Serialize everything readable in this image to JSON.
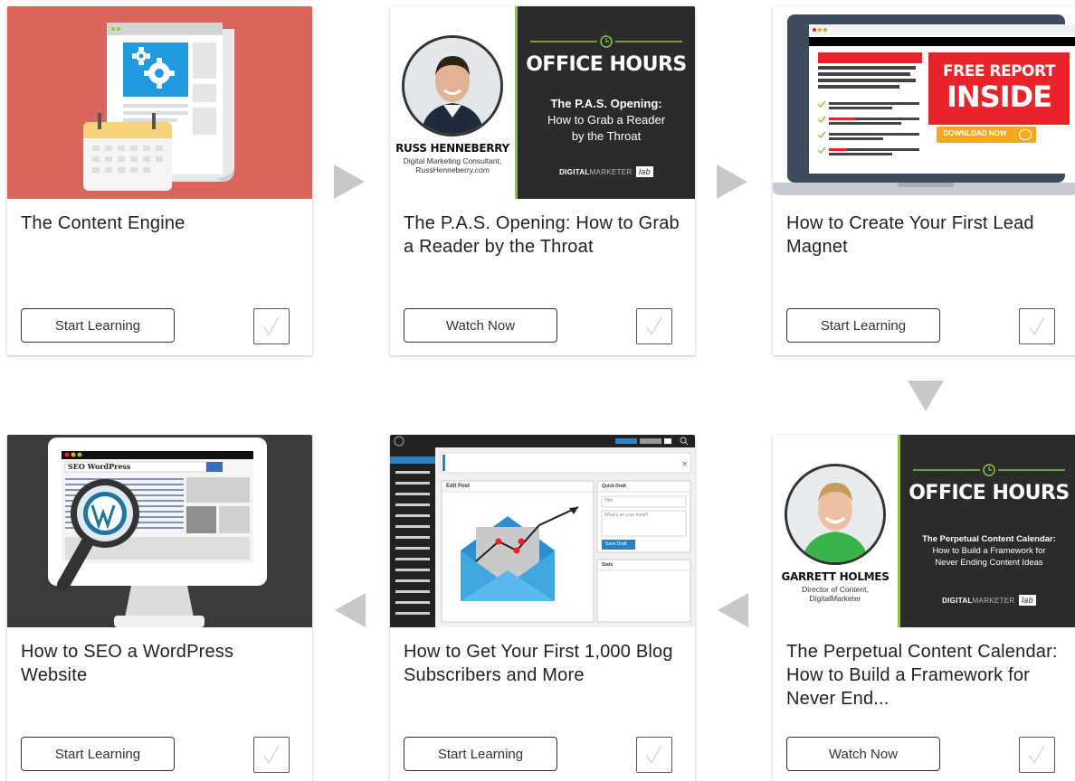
{
  "courses": [
    {
      "title": "The Content Engine",
      "button": "Start Learning"
    },
    {
      "title": "The P.A.S. Opening: How to Grab a Reader by the Throat",
      "button": "Watch Now",
      "thumb": {
        "person": "RUSS HENNEBERRY",
        "role_line1": "Digital Marketing Consultant,",
        "role_line2": "RussHenneberry.com",
        "banner": "OFFICE HOURS",
        "subtitle_bold": "The P.A.S. Opening:",
        "subtitle_rest1": "How to Grab a Reader",
        "subtitle_rest2": "by the Throat",
        "brand_bold": "DIGITAL",
        "brand_light": "MARKETER",
        "brand_lab": "lab"
      }
    },
    {
      "title": "How to Create Your First Lead Magnet",
      "button": "Start Learning",
      "thumb": {
        "report_line1": "FREE REPORT",
        "report_line2": "INSIDE",
        "download": "DOWNLOAD NOW"
      }
    },
    {
      "title": "How to SEO a WordPress Website",
      "button": "Start Learning",
      "thumb": {
        "search_text": "SEO WordPress"
      }
    },
    {
      "title": "How to Get Your First 1,000 Blog Subscribers and More",
      "button": "Start Learning",
      "thumb": {
        "edit_post": "Edit Post",
        "quick_draft": "Quick Draft",
        "title_placeholder": "Title",
        "mind_placeholder": "What's on your mind?",
        "save_draft": "Save Draft",
        "stats": "Stats"
      }
    },
    {
      "title": "The Perpetual Content Calendar: How to Build a Framework for Never End...",
      "button": "Watch Now",
      "thumb": {
        "person": "GARRETT HOLMES",
        "role_line1": "Director of Content,",
        "role_line2": "DigitalMarketer",
        "banner": "OFFICE HOURS",
        "subtitle_bold": "The Perpetual Content Calendar:",
        "subtitle_rest1": "How to Build a Framework for",
        "subtitle_rest2": "Never Ending Content Ideas",
        "brand_bold": "DIGITAL",
        "brand_light": "MARKETER",
        "brand_lab": "lab"
      }
    }
  ],
  "colors": {
    "accent_green": "#8dc63f",
    "report_red": "#e8242a",
    "content_engine_bg": "#d9665b",
    "dark_panel": "#2b2b2b",
    "wp_blue": "#2a82c4"
  }
}
